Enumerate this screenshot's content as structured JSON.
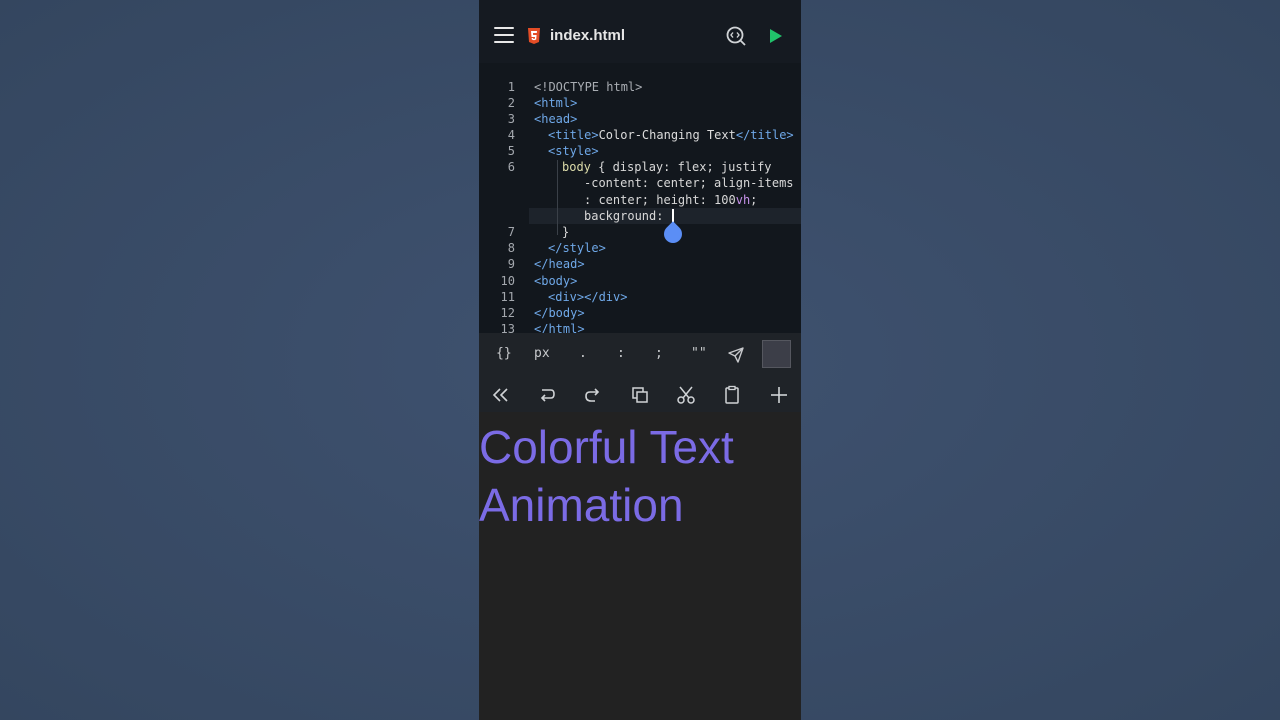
{
  "appbar": {
    "file_name": "index.html"
  },
  "editor": {
    "line_numbers": [
      "1",
      "2",
      "3",
      "4",
      "5",
      "6",
      "7",
      "8",
      "9",
      "10",
      "11",
      "12",
      "13"
    ],
    "lines": {
      "l1": "<!DOCTYPE html>",
      "l2": "<html>",
      "l3": "<head>",
      "l4_open": "<title>",
      "l4_text": "Color-Changing Text",
      "l4_close": "</title>",
      "l5": "<style>",
      "l6a_sel": "body",
      "l6a_rest": " { display: flex; justify",
      "l6b": "-content: center; align-items",
      "l6c_a": ": center; height: 100",
      "l6c_unit": "vh",
      "l6c_b": ";",
      "l6d": "background: ",
      "l7": "}",
      "l8": "</style>",
      "l9": "</head>",
      "l10": "<body>",
      "l11": "<div></div>",
      "l12": "</body>",
      "l13": "</html>"
    }
  },
  "shortcuts": [
    "{}",
    "px",
    ".",
    ":",
    ";",
    "\"\""
  ],
  "preview": {
    "line1": "Colorful Text",
    "line2": "Animation"
  },
  "colors": {
    "accent_blue": "#5b8ef5",
    "run_green": "#21c26b",
    "html5_orange": "#e44d26",
    "preview_text": "#7b6be5"
  }
}
